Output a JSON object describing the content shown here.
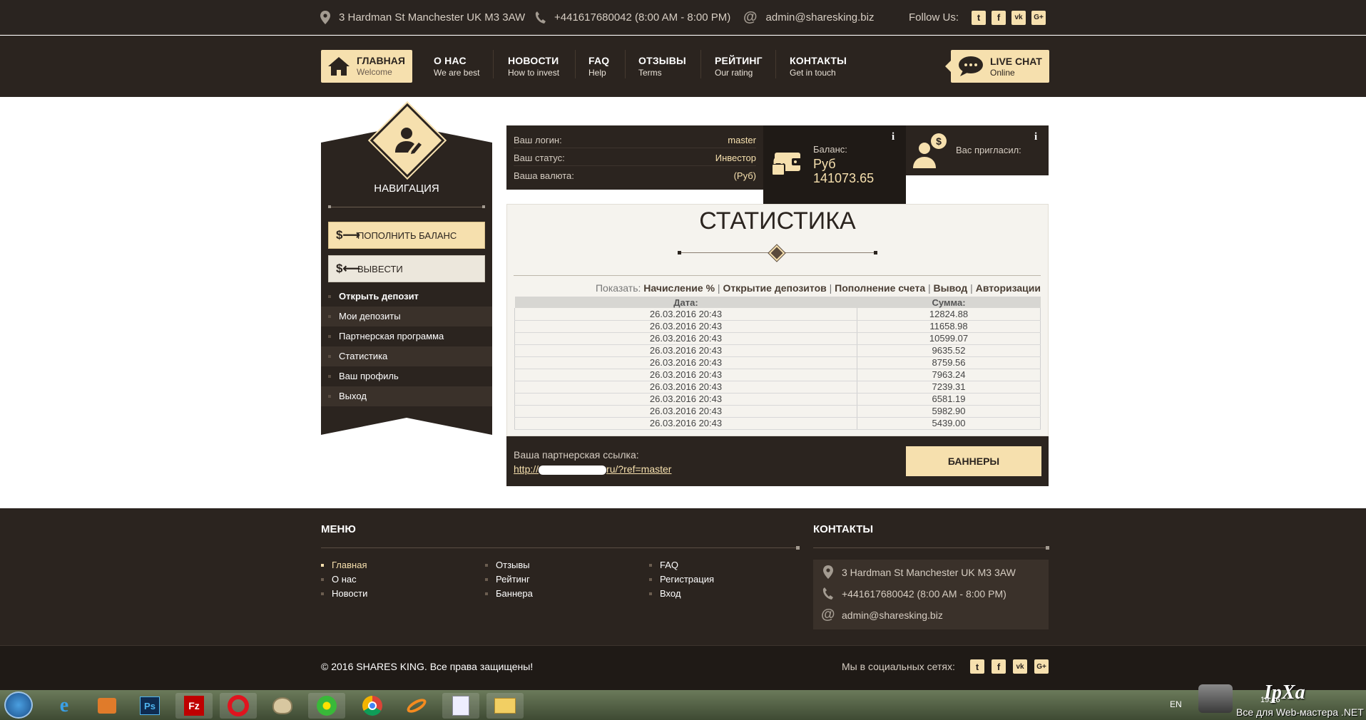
{
  "topbar": {
    "address": "3 Hardman St Manchester UK M3 3AW",
    "phone": "+441617680042 (8:00 AM - 8:00 PM)",
    "email": "admin@sharesking.biz",
    "follow_label": "Follow Us:",
    "social": [
      "t",
      "f",
      "vk",
      "G+"
    ]
  },
  "nav": {
    "items": [
      {
        "title": "ГЛАВНАЯ",
        "sub": "Welcome"
      },
      {
        "title": "О НАС",
        "sub": "We are best"
      },
      {
        "title": "НОВОСТИ",
        "sub": "How to invest"
      },
      {
        "title": "FAQ",
        "sub": "Help"
      },
      {
        "title": "ОТЗЫВЫ",
        "sub": "Terms"
      },
      {
        "title": "РЕЙТИНГ",
        "sub": "Our rating"
      },
      {
        "title": "КОНТАКТЫ",
        "sub": "Get in touch"
      }
    ],
    "live_chat": {
      "title": "LIVE CHAT",
      "sub": "Online"
    }
  },
  "sidebar": {
    "title": "НАВИГАЦИЯ",
    "topup_button": "ПОПОЛНИТЬ БАЛАНС",
    "withdraw_button": "ВЫВЕСТИ",
    "items": [
      "Открыть депозит",
      "Мои депозиты",
      "Партнерская программа",
      "Статистика",
      "Ваш профиль",
      "Выход"
    ]
  },
  "account": {
    "login_label": "Ваш логин:",
    "login_value": "master",
    "status_label": "Ваш статус:",
    "status_value": "Инвестор",
    "currency_label": "Ваша валюта:",
    "currency_value": "(Руб)",
    "balance_label": "Баланс:",
    "balance_currency": "Руб",
    "balance_value": "141073.65",
    "invited_label": "Вас пригласил:",
    "info_icon": "i"
  },
  "stats": {
    "title": "СТАТИСТИКА",
    "show_label": "Показать:",
    "filters": [
      "Начисление %",
      "Открытие депозитов",
      "Пополнение счета",
      "Вывод",
      "Авторизации"
    ],
    "separator": "|",
    "columns": [
      "Дата:",
      "Сумма:"
    ],
    "rows": [
      [
        "26.03.2016 20:43",
        "12824.88"
      ],
      [
        "26.03.2016 20:43",
        "11658.98"
      ],
      [
        "26.03.2016 20:43",
        "10599.07"
      ],
      [
        "26.03.2016 20:43",
        "9635.52"
      ],
      [
        "26.03.2016 20:43",
        "8759.56"
      ],
      [
        "26.03.2016 20:43",
        "7963.24"
      ],
      [
        "26.03.2016 20:43",
        "7239.31"
      ],
      [
        "26.03.2016 20:43",
        "6581.19"
      ],
      [
        "26.03.2016 20:43",
        "5982.90"
      ],
      [
        "26.03.2016 20:43",
        "5439.00"
      ]
    ]
  },
  "partner": {
    "label": "Ваша партнерская ссылка:",
    "link_prefix": "http://",
    "link_suffix": "ru/?ref=master",
    "banners_button": "БАННЕРЫ"
  },
  "footer": {
    "menu_title": "МЕНЮ",
    "menu_col1": [
      "Главная",
      "О нас",
      "Новости"
    ],
    "menu_col2": [
      "Отзывы",
      "Рейтинг",
      "Баннера"
    ],
    "menu_col3": [
      "FAQ",
      "Регистрация",
      "Вход"
    ],
    "contacts_title": "КОНТАКТЫ",
    "address": "3 Hardman St Manchester UK M3 3AW",
    "phone": "+441617680042 (8:00 AM - 8:00 PM)",
    "email": "admin@sharesking.biz",
    "copyright": "© 2016 SHARES KING. Все права защищены!",
    "social_label": "Мы в социальных сетях:"
  },
  "taskbar": {
    "lang": "EN",
    "time": "19:46",
    "watermark": "IpXa",
    "watermark_sub": "Все для Web-мастера .NET",
    "apps": [
      "Ps",
      "Fz"
    ]
  },
  "colors": {
    "dark": "#2b241f",
    "accent": "#f6e0ae",
    "light_button": "#ece7dc"
  }
}
